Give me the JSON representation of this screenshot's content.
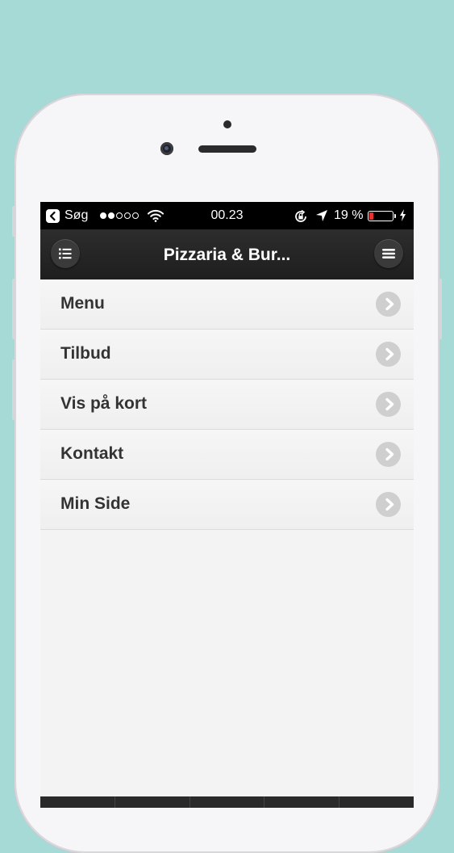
{
  "status_bar": {
    "back_app": "Søg",
    "time": "00.23",
    "battery_percent": "19 %",
    "battery_level": 0.19,
    "signal_bars_filled": 2,
    "signal_bars_total": 5,
    "icons": [
      "back-icon",
      "wifi-icon",
      "rotation-lock-icon",
      "location-icon",
      "battery-icon",
      "charging-bolt-icon"
    ]
  },
  "header": {
    "title": "Pizzaria & Bur...",
    "left_button_icon": "list-icon",
    "right_button_icon": "hamburger-menu-icon"
  },
  "menu": {
    "items": [
      {
        "label": "Menu"
      },
      {
        "label": "Tilbud"
      },
      {
        "label": "Vis på kort"
      },
      {
        "label": "Kontakt"
      },
      {
        "label": "Min Side"
      }
    ],
    "row_icon": "chevron-right-icon"
  },
  "colors": {
    "background": "#a6dad6",
    "header": "#262626",
    "list_bg": "#f3f3f3",
    "text": "#333333",
    "chevron_bg": "#cfcfcf",
    "battery_fill": "#e33333"
  }
}
